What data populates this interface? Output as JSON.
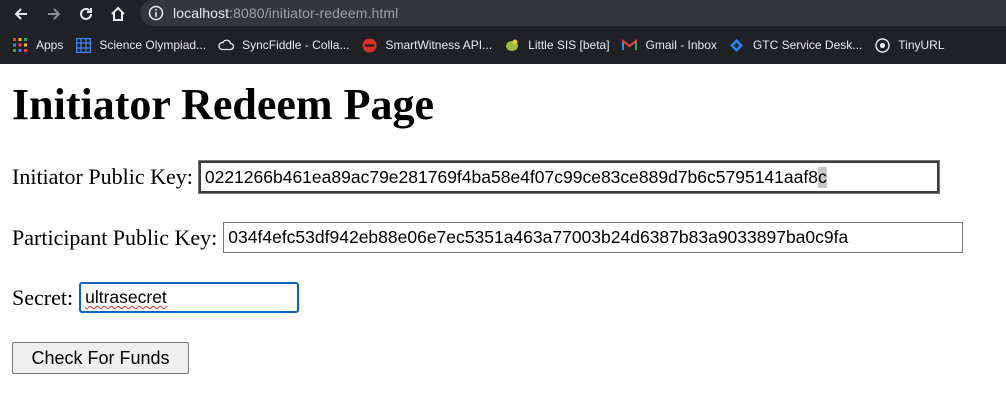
{
  "browser": {
    "url_host": "localhost",
    "url_rest": ":8080/initiator-redeem.html",
    "bookmarks": [
      {
        "label": "Apps",
        "icon": "apps-grid-icon",
        "color": "#ea4335"
      },
      {
        "label": "Science Olympiad...",
        "icon": "grid-table-icon",
        "color": "#4285f4"
      },
      {
        "label": "SyncFiddle - Colla...",
        "icon": "cloud-icon",
        "color": "#e8eaed"
      },
      {
        "label": "SmartWitness API...",
        "icon": "red-circle-icon",
        "color": "#d93025"
      },
      {
        "label": "Little SIS [beta]",
        "icon": "leaf-icon",
        "color": "#9bbb3b"
      },
      {
        "label": "Gmail - Inbox",
        "icon": "gmail-icon",
        "color": "#ea4335"
      },
      {
        "label": "GTC Service Desk...",
        "icon": "jira-icon",
        "color": "#2684ff"
      },
      {
        "label": "TinyURL",
        "icon": "globe-icon",
        "color": "#e8eaed"
      }
    ]
  },
  "page": {
    "title": "Initiator Redeem Page",
    "initiator_label": "Initiator Public Key:",
    "initiator_value": "0221266b461ea89ac79e281769f4ba58e4f07c99ce83ce889d7b6c5795141aaf8",
    "initiator_value_selected_tail": "c",
    "participant_label": "Participant Public Key:",
    "participant_value": "034f4efc53df942eb88e06e7ec5351a463a77003b24d6387b83a9033897ba0c9fa",
    "secret_label": "Secret:",
    "secret_value": "ultrasecret",
    "check_button": "Check For Funds"
  }
}
